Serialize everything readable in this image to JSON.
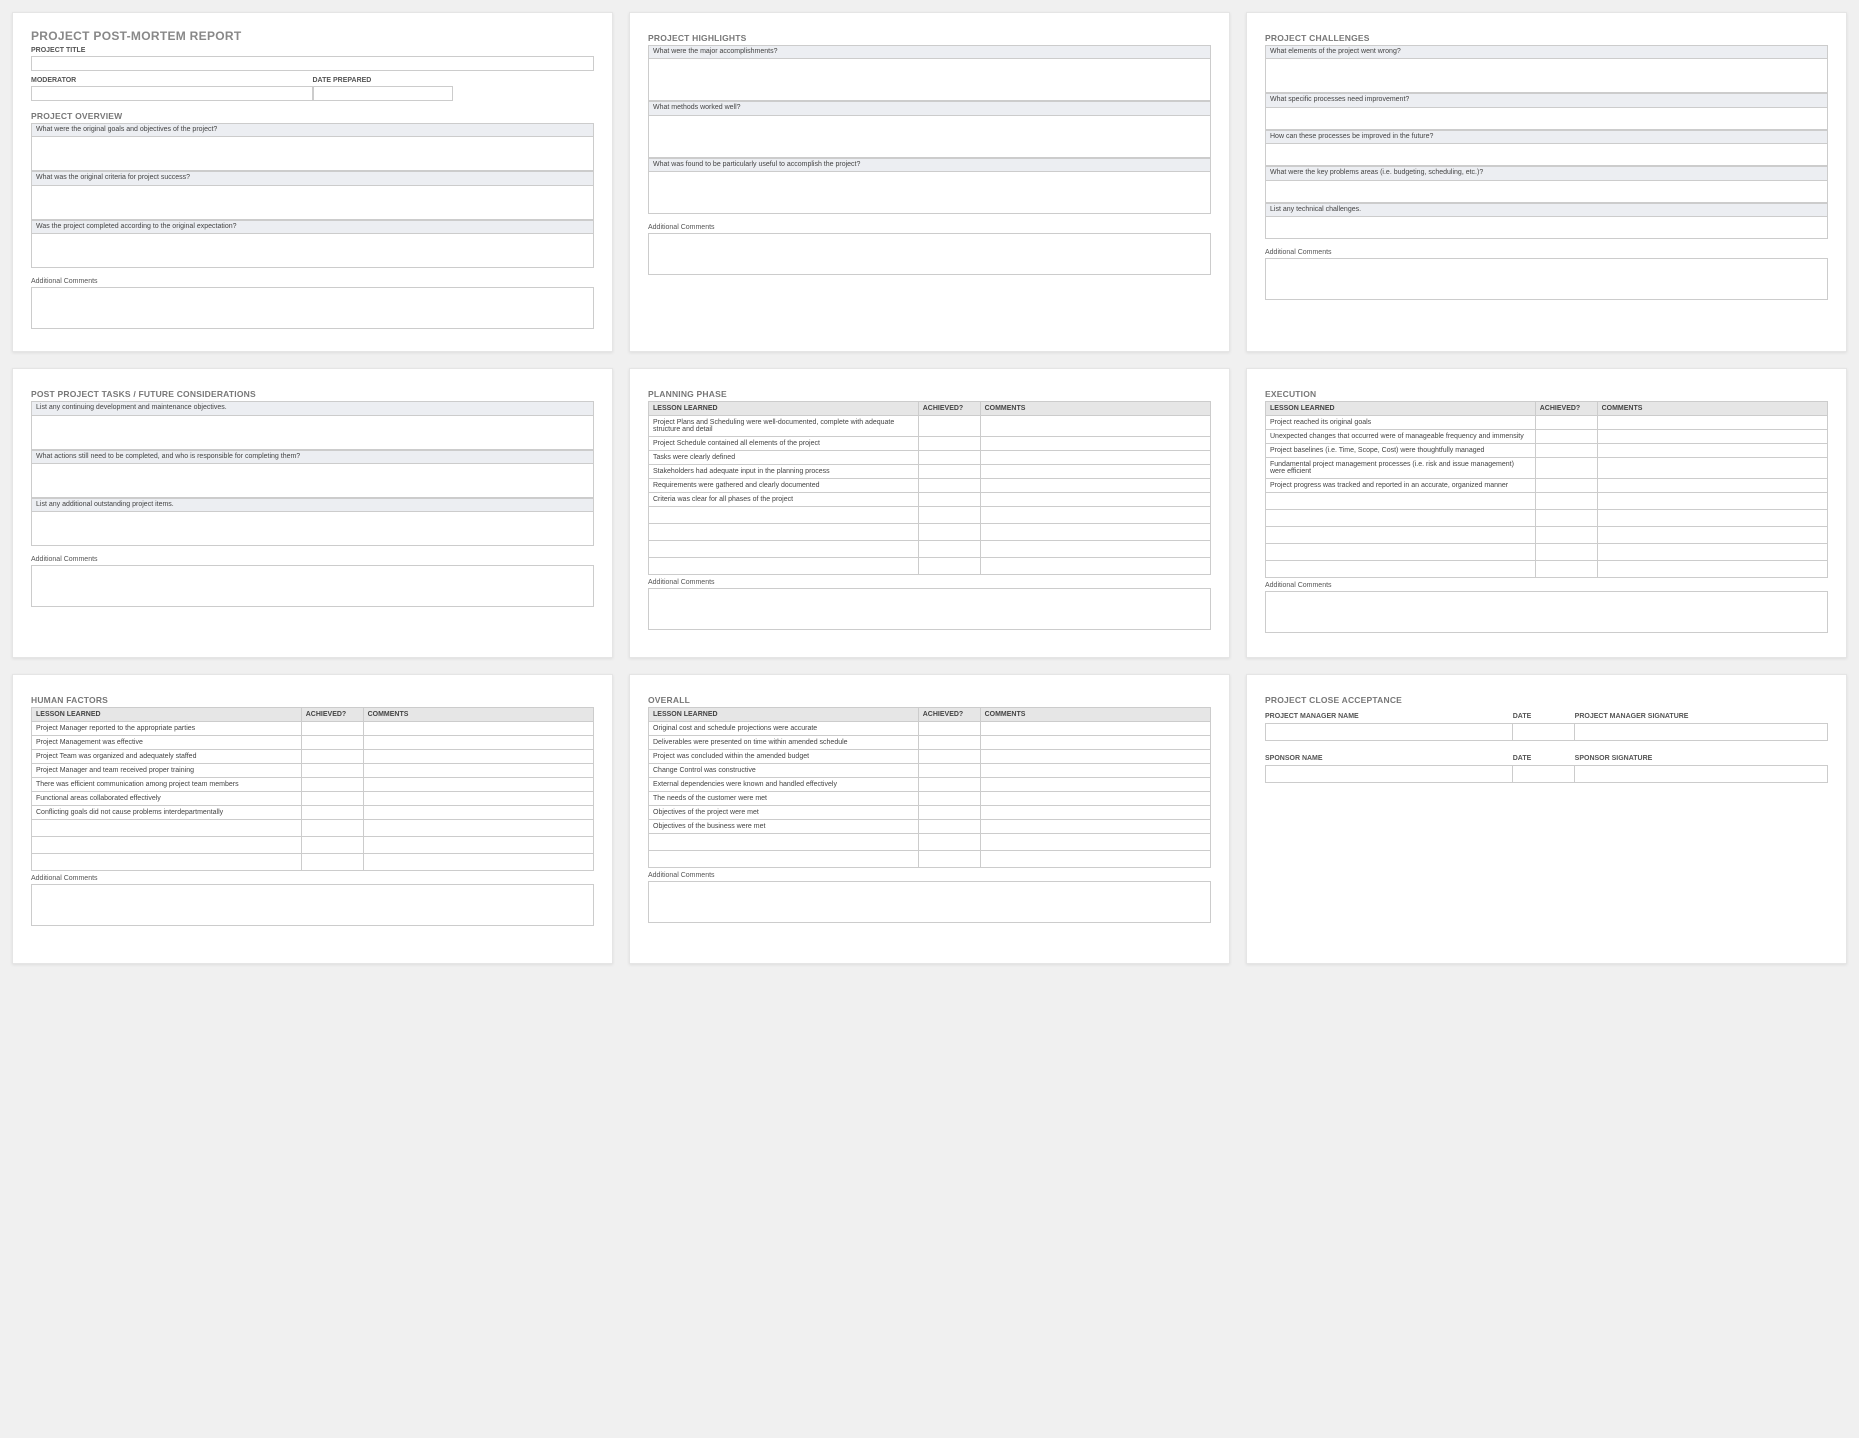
{
  "report": {
    "title": "PROJECT POST-MORTEM REPORT",
    "project_title_label": "PROJECT TITLE",
    "moderator_label": "MODERATOR",
    "date_prepared_label": "DATE PREPARED",
    "overview_title": "PROJECT OVERVIEW",
    "q_goals": "What were the original goals and objectives of the project?",
    "q_criteria": "What was the original criteria for project success?",
    "q_completed": "Was the project completed according to the original expectation?",
    "additional_comments": "Additional Comments"
  },
  "highlights": {
    "title": "PROJECT HIGHLIGHTS",
    "q_accomplishments": "What were the major accomplishments?",
    "q_methods": "What methods worked well?",
    "q_useful": "What was found to be particularly useful to accomplish the project?",
    "additional_comments": "Additional Comments"
  },
  "challenges": {
    "title": "PROJECT CHALLENGES",
    "q_wrong": "What elements of the project went wrong?",
    "q_processes": "What specific processes need improvement?",
    "q_improve": "How can these processes be improved in the future?",
    "q_problems": "What were the key problems areas (i.e. budgeting, scheduling, etc.)?",
    "q_technical": "List any technical challenges.",
    "additional_comments": "Additional Comments"
  },
  "post_tasks": {
    "title": "POST PROJECT TASKS / FUTURE CONSIDERATIONS",
    "q_continuing": "List any continuing development and maintenance objectives.",
    "q_actions": "What actions still need to be completed, and who is responsible for completing them?",
    "q_outstanding": "List any additional outstanding project items.",
    "additional_comments": "Additional Comments"
  },
  "table_headers": {
    "lesson": "LESSON LEARNED",
    "achieved": "ACHIEVED?",
    "comments": "COMMENTS"
  },
  "planning": {
    "title": "PLANNING PHASE",
    "rows": [
      "Project Plans and Scheduling were well-documented, complete with adequate structure and detail",
      "Project Schedule contained all elements of the project",
      "Tasks were clearly defined",
      "Stakeholders had adequate input in the planning process",
      "Requirements were gathered and clearly documented",
      "Criteria was clear for all phases of the project",
      "",
      "",
      "",
      ""
    ],
    "additional_comments": "Additional Comments"
  },
  "execution": {
    "title": "EXECUTION",
    "rows": [
      "Project reached its original goals",
      "Unexpected changes that occurred were of manageable frequency and immensity",
      "Project baselines (i.e. Time, Scope, Cost) were thoughtfully managed",
      "Fundamental project management processes (i.e. risk and issue management) were efficient",
      "Project progress was tracked and reported in an accurate, organized manner",
      "",
      "",
      "",
      "",
      ""
    ],
    "additional_comments": "Additional Comments"
  },
  "human": {
    "title": "HUMAN FACTORS",
    "rows": [
      "Project Manager reported to the appropriate parties",
      "Project Management was effective",
      "Project Team was organized and adequately staffed",
      "Project Manager and team received proper training",
      "There was efficient communication among project team members",
      "Functional areas collaborated effectively",
      "Conflicting goals did not cause problems interdepartmentally",
      "",
      "",
      ""
    ],
    "additional_comments": "Additional Comments"
  },
  "overall": {
    "title": "OVERALL",
    "rows": [
      "Original cost and schedule projections were accurate",
      "Deliverables were presented on time within amended schedule",
      "Project was concluded within the amended budget",
      "Change Control was constructive",
      "External dependencies were known and handled effectively",
      "The needs of the customer were met",
      "Objectives of the project were met",
      "Objectives of the business were met",
      "",
      ""
    ],
    "additional_comments": "Additional Comments"
  },
  "acceptance": {
    "title": "PROJECT CLOSE ACCEPTANCE",
    "pm_name": "PROJECT MANAGER NAME",
    "date": "DATE",
    "pm_sig": "PROJECT MANAGER SIGNATURE",
    "sponsor_name": "SPONSOR NAME",
    "sponsor_sig": "SPONSOR SIGNATURE"
  }
}
